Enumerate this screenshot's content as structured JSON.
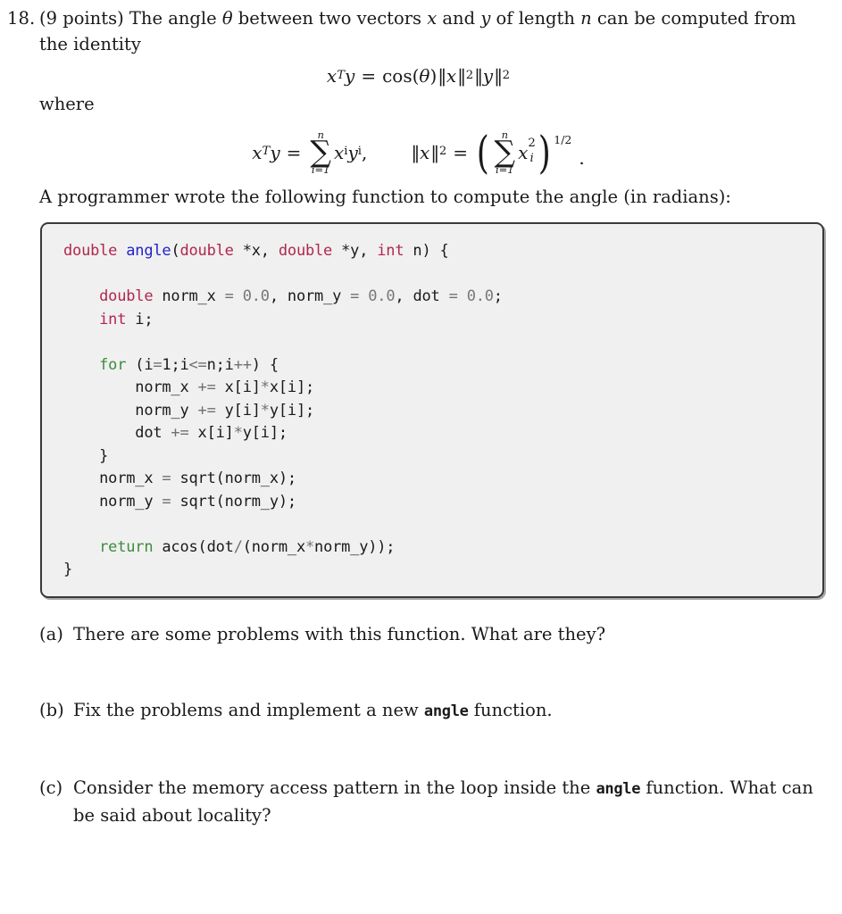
{
  "problem": {
    "number": "18.",
    "points": "(9 points)",
    "intro_before": "(9 points) The angle ",
    "intro_theta": "θ",
    "intro_mid1": " between two vectors ",
    "intro_x": "x",
    "intro_mid2": " and ",
    "intro_y": "y",
    "intro_mid3": " of length ",
    "intro_n": "n",
    "intro_after": " can be computed from the identity",
    "where_label": "where",
    "programmer_line": "A programmer wrote the following function to compute the angle (in radians):"
  },
  "equations": {
    "identity": {
      "lhs_x": "x",
      "lhs_sup": "T",
      "lhs_y": "y",
      "equals": "=",
      "cos": "cos(",
      "theta": "θ",
      "close": ")",
      "normx_open": "‖",
      "normx_var": "x",
      "normx_close": "‖",
      "normx_sub": "2",
      "normy_open": "‖",
      "normy_var": "y",
      "normy_close": "‖",
      "normy_sub": "2",
      "plain": "x^T y = cos(θ)‖x‖₂‖y‖₂"
    },
    "definitions": {
      "dot_x": "x",
      "dot_sup": "T",
      "dot_y": "y",
      "equals": "=",
      "sum_top": "n",
      "sum_glyph": "∑",
      "sum_bottom": "i=1",
      "dot_terms": "x",
      "dot_sub1": "i",
      "dot_terms2": "y",
      "dot_sub2": "i",
      "comma": ",",
      "norm_open": "‖",
      "norm_var": "x",
      "norm_close": "‖",
      "norm_sub": "2",
      "norm_equals": "=",
      "paren_open": "(",
      "paren_close": ")",
      "sum2_top": "n",
      "sum2_glyph": "∑",
      "sum2_bottom": "i=1",
      "sq_var": "x",
      "sq_sub": "i",
      "sq_sup": "2",
      "exponent": "1/2",
      "period": ".",
      "plain": "x^T y = sum_{i=1}^{n} x_i y_i,   ||x||_2 = ( sum_{i=1}^{n} x_i^2 )^{1/2} ."
    }
  },
  "code": {
    "language": "c",
    "lines": [
      {
        "indent": 0,
        "tokens": [
          {
            "t": "double ",
            "c": "k-type"
          },
          {
            "t": "angle",
            "c": "fn"
          },
          {
            "t": "(",
            "c": ""
          },
          {
            "t": "double ",
            "c": "k-type"
          },
          {
            "t": "*x, ",
            "c": ""
          },
          {
            "t": "double ",
            "c": "k-type"
          },
          {
            "t": "*y, ",
            "c": ""
          },
          {
            "t": "int ",
            "c": "k-type"
          },
          {
            "t": "n) {",
            "c": ""
          }
        ]
      },
      {
        "indent": 0,
        "tokens": [
          {
            "t": "",
            "c": ""
          }
        ]
      },
      {
        "indent": 1,
        "tokens": [
          {
            "t": "double ",
            "c": "k-type"
          },
          {
            "t": "norm_x ",
            "c": ""
          },
          {
            "t": "=",
            "c": "opg"
          },
          {
            "t": " ",
            "c": ""
          },
          {
            "t": "0.0",
            "c": "num"
          },
          {
            "t": ", norm_y ",
            "c": ""
          },
          {
            "t": "=",
            "c": "opg"
          },
          {
            "t": " ",
            "c": ""
          },
          {
            "t": "0.0",
            "c": "num"
          },
          {
            "t": ", dot ",
            "c": ""
          },
          {
            "t": "=",
            "c": "opg"
          },
          {
            "t": " ",
            "c": ""
          },
          {
            "t": "0.0",
            "c": "num"
          },
          {
            "t": ";",
            "c": ""
          }
        ]
      },
      {
        "indent": 1,
        "tokens": [
          {
            "t": "int ",
            "c": "k-type"
          },
          {
            "t": "i;",
            "c": ""
          }
        ]
      },
      {
        "indent": 0,
        "tokens": [
          {
            "t": "",
            "c": ""
          }
        ]
      },
      {
        "indent": 1,
        "tokens": [
          {
            "t": "for",
            "c": "k-ctrl"
          },
          {
            "t": " (i",
            "c": ""
          },
          {
            "t": "=",
            "c": "opg"
          },
          {
            "t": "1;i",
            "c": ""
          },
          {
            "t": "<=",
            "c": "opg"
          },
          {
            "t": "n;i",
            "c": ""
          },
          {
            "t": "++",
            "c": "opg"
          },
          {
            "t": ") {",
            "c": ""
          }
        ]
      },
      {
        "indent": 2,
        "tokens": [
          {
            "t": "norm_x ",
            "c": ""
          },
          {
            "t": "+=",
            "c": "opg"
          },
          {
            "t": " x[i]",
            "c": ""
          },
          {
            "t": "*",
            "c": "opg"
          },
          {
            "t": "x[i];",
            "c": ""
          }
        ]
      },
      {
        "indent": 2,
        "tokens": [
          {
            "t": "norm_y ",
            "c": ""
          },
          {
            "t": "+=",
            "c": "opg"
          },
          {
            "t": " y[i]",
            "c": ""
          },
          {
            "t": "*",
            "c": "opg"
          },
          {
            "t": "y[i];",
            "c": ""
          }
        ]
      },
      {
        "indent": 2,
        "tokens": [
          {
            "t": "dot ",
            "c": ""
          },
          {
            "t": "+=",
            "c": "opg"
          },
          {
            "t": " x[i]",
            "c": ""
          },
          {
            "t": "*",
            "c": "opg"
          },
          {
            "t": "y[i];",
            "c": ""
          }
        ]
      },
      {
        "indent": 1,
        "tokens": [
          {
            "t": "}",
            "c": ""
          }
        ]
      },
      {
        "indent": 1,
        "tokens": [
          {
            "t": "norm_x ",
            "c": ""
          },
          {
            "t": "=",
            "c": "opg"
          },
          {
            "t": " sqrt(norm_x);",
            "c": ""
          }
        ]
      },
      {
        "indent": 1,
        "tokens": [
          {
            "t": "norm_y ",
            "c": ""
          },
          {
            "t": "=",
            "c": "opg"
          },
          {
            "t": " sqrt(norm_y);",
            "c": ""
          }
        ]
      },
      {
        "indent": 0,
        "tokens": [
          {
            "t": "",
            "c": ""
          }
        ]
      },
      {
        "indent": 1,
        "tokens": [
          {
            "t": "return",
            "c": "k-ctrl"
          },
          {
            "t": " acos(dot",
            "c": ""
          },
          {
            "t": "/",
            "c": "opg"
          },
          {
            "t": "(norm_x",
            "c": ""
          },
          {
            "t": "*",
            "c": "opg"
          },
          {
            "t": "norm_y));",
            "c": ""
          }
        ]
      },
      {
        "indent": 0,
        "tokens": [
          {
            "t": "}",
            "c": ""
          }
        ]
      }
    ],
    "plain_text": "double angle(double *x, double *y, int n) {\n\n    double norm_x = 0.0, norm_y = 0.0, dot = 0.0;\n    int i;\n\n    for (i=1;i<=n;i++) {\n        norm_x += x[i]*x[i];\n        norm_y += y[i]*y[i];\n        dot += x[i]*y[i];\n    }\n    norm_x = sqrt(norm_x);\n    norm_y = sqrt(norm_y);\n\n    return acos(dot/(norm_x*norm_y));\n}"
  },
  "subparts": [
    {
      "label": "(a)",
      "text_parts": [
        {
          "kind": "plain",
          "text": "There are some problems with this function. What are they?"
        }
      ]
    },
    {
      "label": "(b)",
      "text_parts": [
        {
          "kind": "plain",
          "text": "Fix the problems and implement a new "
        },
        {
          "kind": "code",
          "text": "angle"
        },
        {
          "kind": "plain",
          "text": " function."
        }
      ]
    },
    {
      "label": "(c)",
      "text_parts": [
        {
          "kind": "plain",
          "text": "Consider the memory access pattern in the loop inside the "
        },
        {
          "kind": "code",
          "text": "angle"
        },
        {
          "kind": "plain",
          "text": " function. What can be said about locality?"
        }
      ]
    }
  ],
  "colors": {
    "page_background": "#ffffff",
    "text": "#1a1a1a",
    "code_background": "#f0f0f0",
    "code_border": "#3a3a3a",
    "keyword_type": "#b0274d",
    "keyword_control": "#3d8b3d",
    "function_name": "#2222cc",
    "numeric_literal": "#787878",
    "operator": "#707070"
  }
}
